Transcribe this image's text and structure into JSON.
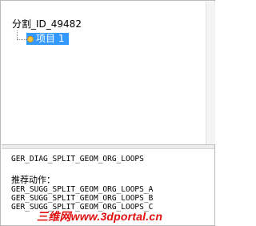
{
  "tree": {
    "root_label": "分割_ID_49482",
    "child_label": "项目 1"
  },
  "detail": {
    "error_code": "GER_DIAG_SPLIT_GEOM_ORG_LOOPS",
    "suggested_actions_label": "推荐动作：",
    "suggested_actions": [
      "GER_SUGG_SPLIT_GEOM_ORG_LOOPS_A",
      "GER_SUGG_SPLIT_GEOM_ORG_LOOPS_B",
      "GER_SUGG_SPLIT_GEOM_ORG_LOOPS_C"
    ]
  },
  "watermark": {
    "text": "三维网www.3dportal.cn",
    "color": "#e01010"
  },
  "colors": {
    "selection": "#3399ff",
    "item_icon": "#f7c23b"
  }
}
